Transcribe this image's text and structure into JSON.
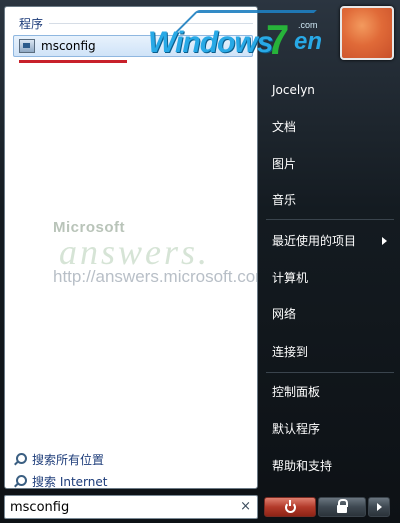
{
  "programs": {
    "header": "程序",
    "items": [
      {
        "label": "msconfig",
        "icon": "msconfig-app-icon"
      }
    ]
  },
  "watermark": {
    "brand": "Microsoft",
    "word": "answers.",
    "url": "http://answers.microsoft.com"
  },
  "search_links": [
    {
      "label": "搜索所有位置",
      "icon": "search-icon"
    },
    {
      "label": "搜索 Internet",
      "icon": "search-icon"
    }
  ],
  "search": {
    "value": "msconfig",
    "clear_glyph": "×"
  },
  "logo": {
    "text": "Windows",
    "seven": "7",
    "suffix": "en",
    "com": ".com"
  },
  "right_menu": {
    "user": "Jocelyn",
    "documents": "文档",
    "pictures": "图片",
    "music": "音乐",
    "recent": "最近使用的项目",
    "computer": "计算机",
    "network": "网络",
    "connect": "连接到",
    "control_panel": "控制面板",
    "default_programs": "默认程序",
    "help": "帮助和支持"
  },
  "colors": {
    "accent": "#1e3d7a",
    "underline": "#c8202a",
    "power": "#b33a2a"
  }
}
